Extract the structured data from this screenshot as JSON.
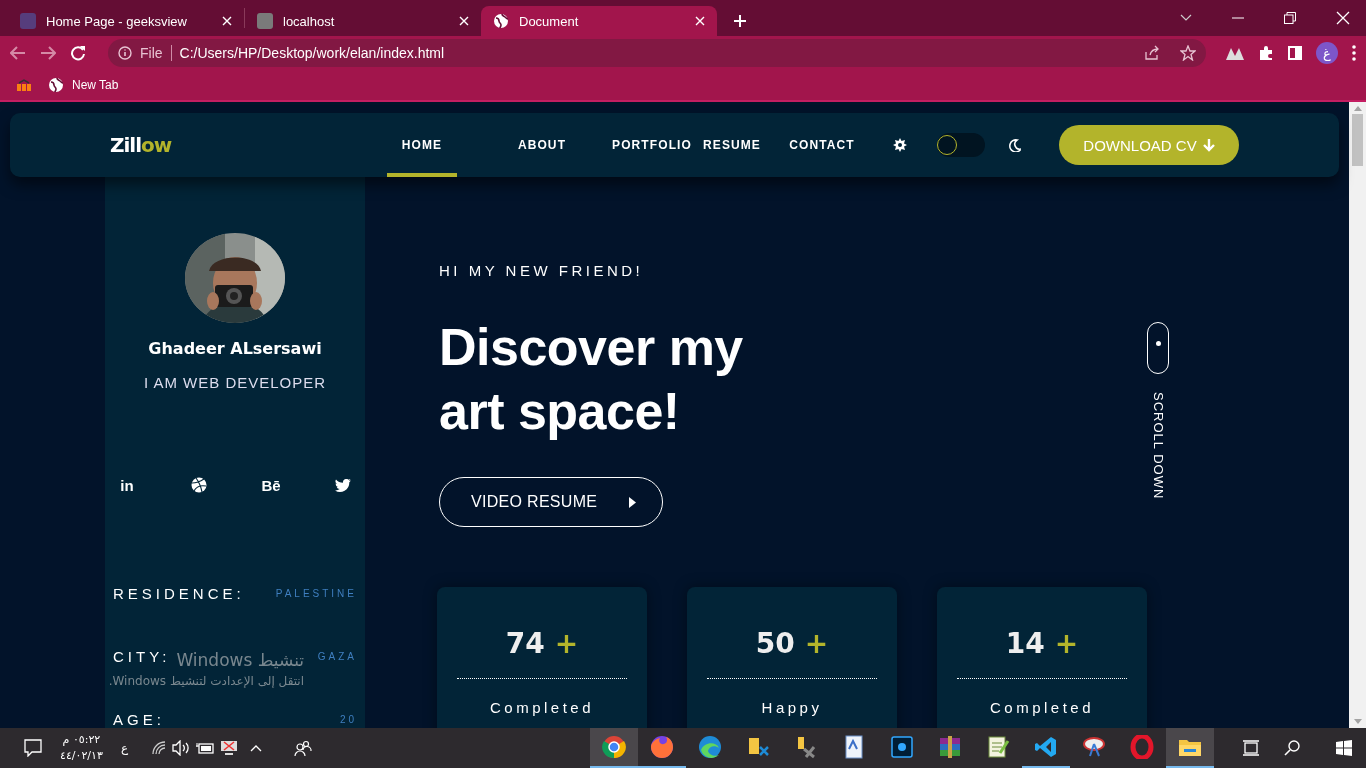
{
  "browser": {
    "tabs": [
      {
        "title": "Home Page - geeksview",
        "selected": false
      },
      {
        "title": "localhost",
        "selected": false
      },
      {
        "title": "Document",
        "selected": true
      }
    ],
    "address": {
      "scheme": "File",
      "url": "C:/Users/HP/Desktop/work/elan/index.html"
    },
    "profile": "غ",
    "bookmarks": [
      {
        "label": "New Tab"
      }
    ]
  },
  "site": {
    "logo": {
      "main": "Zill",
      "accent": "ow"
    },
    "nav": [
      {
        "label": "HOME",
        "selected": true
      },
      {
        "label": "ABOUT",
        "selected": false
      },
      {
        "label": "PORTFOLIO",
        "selected": false
      },
      {
        "label": "RESUME",
        "selected": false
      },
      {
        "label": "CONTACT",
        "selected": false
      }
    ],
    "theme_toggle": {
      "on": false
    },
    "download_button": "DOWNLOAD CV",
    "sidebar": {
      "name": "Ghadeer ALsersawi",
      "role": "I AM WEB DEVELOPER",
      "socials": [
        {
          "kind": "linkedin",
          "glyph": "in"
        },
        {
          "kind": "dribbble"
        },
        {
          "kind": "behance",
          "glyph": "Bē"
        },
        {
          "kind": "twitter"
        }
      ],
      "info": [
        {
          "label": "RESIDENCE:",
          "value": "PALESTINE"
        },
        {
          "label": "CITY:",
          "value": "GAZA"
        },
        {
          "label": "AGE:",
          "value": "20"
        }
      ]
    },
    "hero": {
      "eyebrow": "HI MY NEW FRIEND!",
      "title": "Discover my art space!",
      "video_button": "VIDEO RESUME"
    },
    "scroll_label": "SCROLL DOWN",
    "stats": [
      {
        "number": "74",
        "plus": "+",
        "label": "Completed"
      },
      {
        "number": "50",
        "plus": "+",
        "label": "Happy"
      },
      {
        "number": "14",
        "plus": "+",
        "label": "Completed"
      }
    ]
  },
  "activation_notice": {
    "title": "تنشيط Windows",
    "text": "انتقل إلى الإعدادت لتنشيط Windows."
  },
  "taskbar": {
    "time": "٠٥:٢٢ م",
    "date": "٤٤/٠٢/١٣",
    "language": "ع",
    "apps": [
      {
        "kind": "chrome",
        "running": true,
        "active": true
      },
      {
        "kind": "fox",
        "running": true,
        "active": false
      },
      {
        "kind": "wave",
        "running": false,
        "active": false
      },
      {
        "kind": "folder-tool",
        "running": false,
        "active": false
      },
      {
        "kind": "tools",
        "running": false,
        "active": false
      },
      {
        "kind": "document",
        "running": false,
        "active": false
      },
      {
        "kind": "ps",
        "running": false,
        "active": false
      },
      {
        "kind": "archive",
        "running": false,
        "active": false
      },
      {
        "kind": "notepad",
        "running": false,
        "active": false
      },
      {
        "kind": "code",
        "running": true,
        "active": false
      },
      {
        "kind": "dish",
        "running": false,
        "active": false
      },
      {
        "kind": "ring",
        "running": false,
        "active": false
      },
      {
        "kind": "folder",
        "running": true,
        "active": true
      }
    ]
  }
}
